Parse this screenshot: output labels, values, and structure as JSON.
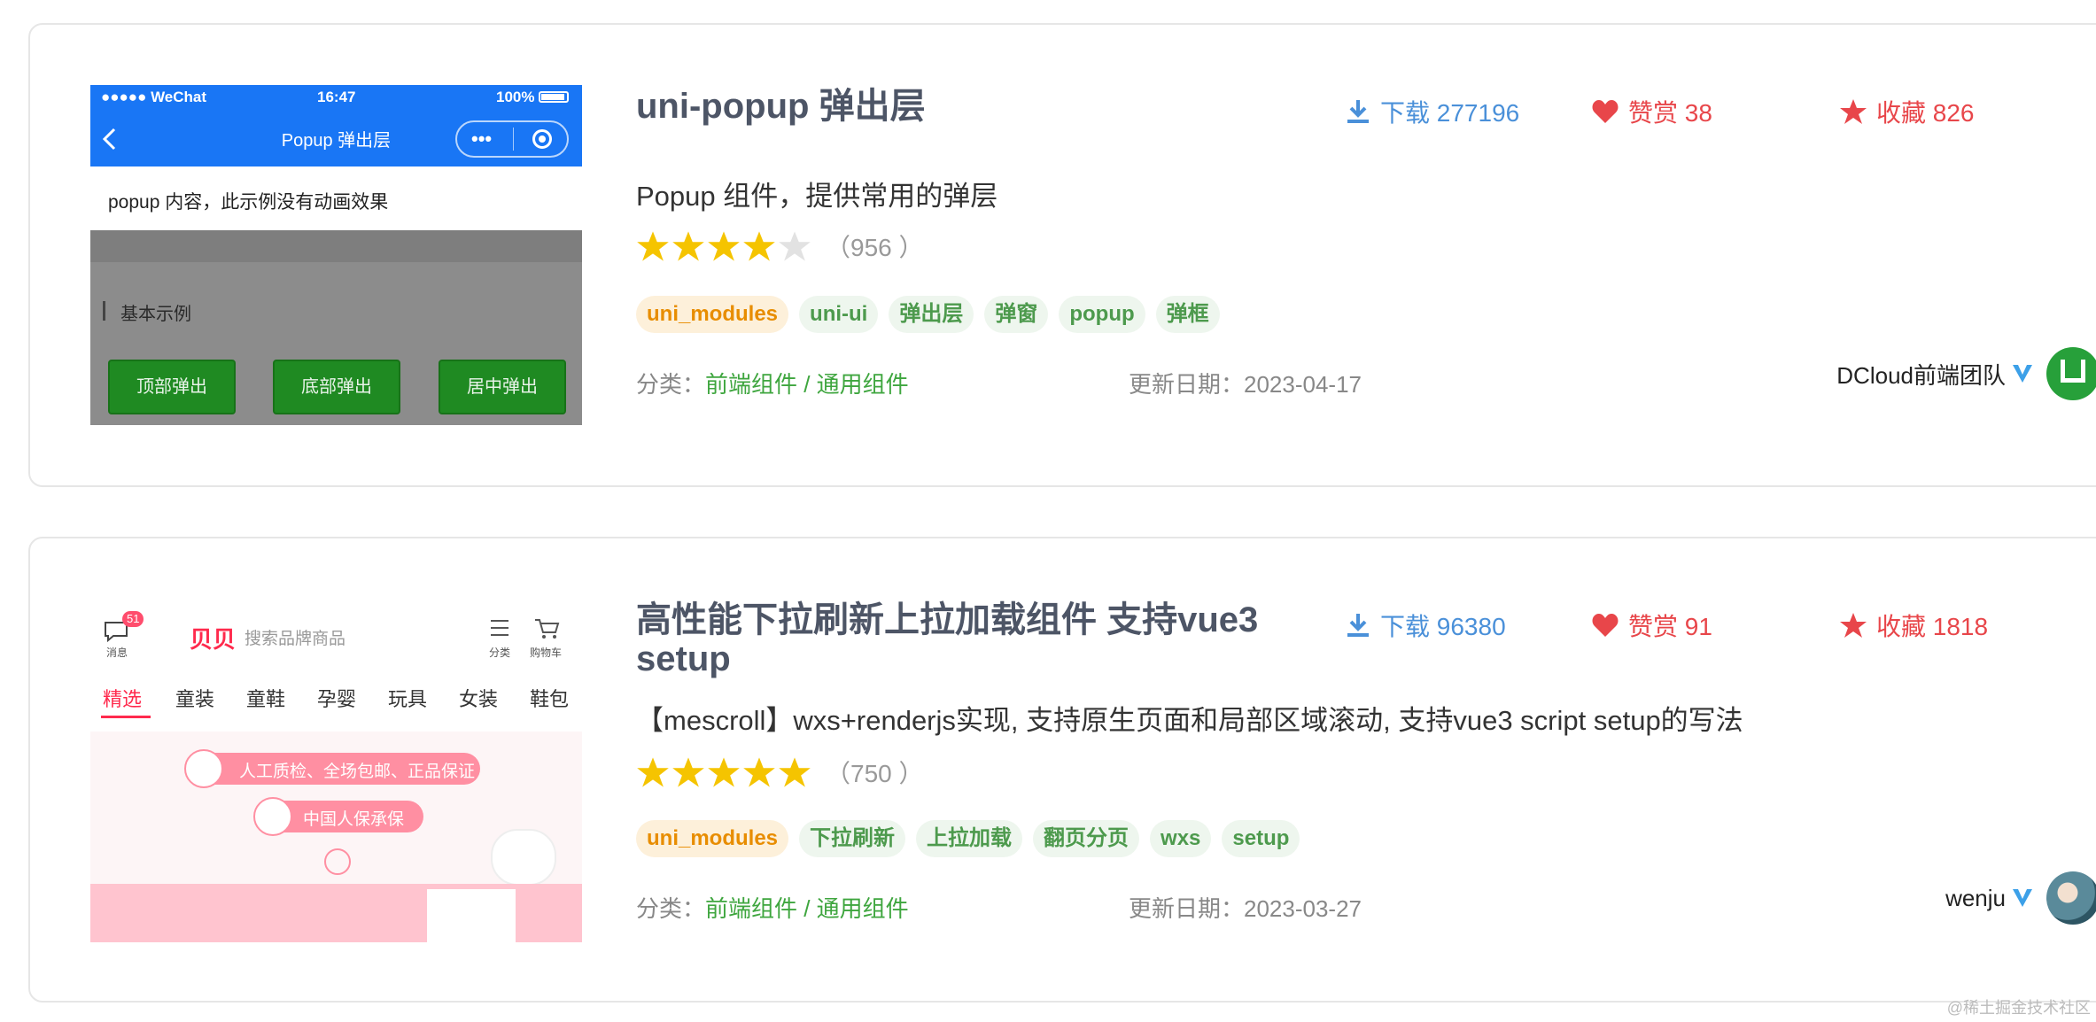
{
  "modules": [
    {
      "title": "uni-popup 弹出层",
      "downloads": "下载 277196",
      "likes": "赞赏 38",
      "favorites": "收藏 826",
      "description": "Popup 组件，提供常用的弹层",
      "rating": 4,
      "rating_count": "（956 ）",
      "tags": [
        "uni_modules",
        "uni-ui",
        "弹出层",
        "弹窗",
        "popup",
        "弹框"
      ],
      "category_label": "分类：",
      "category": "前端组件 / 通用组件",
      "updated": "更新日期：2023-04-17",
      "author": "DCloud前端团队",
      "thumbnail": {
        "status_carrier": "●●●●● WeChat",
        "status_time": "16:47",
        "status_battery": "100%",
        "nav_title": "Popup 弹出层",
        "popup_text": "popup 内容，此示例没有动画效果",
        "section_label": "基本示例",
        "buttons": [
          "顶部弹出",
          "底部弹出",
          "居中弹出"
        ]
      }
    },
    {
      "title": "高性能下拉刷新上拉加载组件 支持vue3 setup",
      "downloads": "下载 96380",
      "likes": "赞赏 91",
      "favorites": "收藏 1818",
      "description": "【mescroll】wxs+renderjs实现, 支持原生页面和局部区域滚动, 支持vue3 script setup的写法",
      "rating": 5,
      "rating_count": "（750 ）",
      "tags": [
        "uni_modules",
        "下拉刷新",
        "上拉加载",
        "翻页分页",
        "wxs",
        "setup"
      ],
      "category_label": "分类：",
      "category": "前端组件 / 通用组件",
      "updated": "更新日期：2023-03-27",
      "author": "wenju",
      "thumbnail": {
        "msg_badge": "51",
        "msg_label": "消息",
        "logo": "贝贝",
        "search_placeholder": "搜索品牌商品",
        "menu_label": "分类",
        "cart_label": "购物车",
        "tabs": [
          "精选",
          "童装",
          "童鞋",
          "孕婴",
          "玩具",
          "女装",
          "鞋包"
        ],
        "banner_1": "人工质检、全场包邮、正品保证",
        "banner_2": "中国人保承保"
      }
    }
  ],
  "watermark": "@稀土掘金技术社区",
  "colors": {
    "title": "#4d5566",
    "download": "#4a90d9",
    "like": "#e8464a",
    "star": "#f5c400",
    "tag_text": "#4d9a4d",
    "tag_primary": "#e88d00",
    "category": "#3fa63f"
  }
}
